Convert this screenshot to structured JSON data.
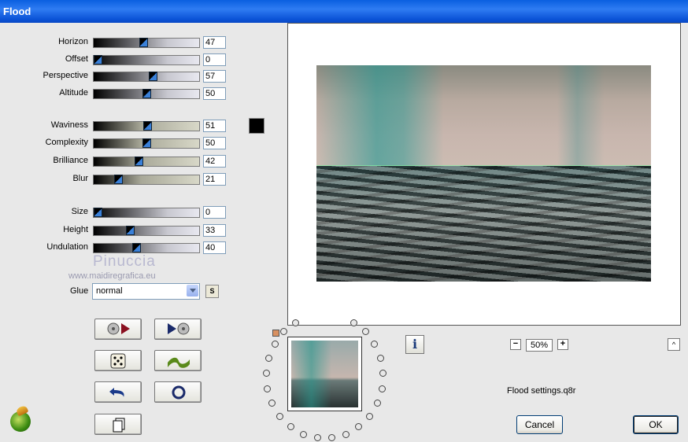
{
  "window": {
    "title": "Flood"
  },
  "params": [
    {
      "label": "Horizon",
      "value": "47",
      "fraction": 0.47,
      "style": "gray"
    },
    {
      "label": "Offset",
      "value": "0",
      "fraction": 0.0,
      "style": "gray"
    },
    {
      "label": "Perspective",
      "value": "57",
      "fraction": 0.57,
      "style": "gray"
    },
    {
      "label": "Altitude",
      "value": "50",
      "fraction": 0.5,
      "style": "gray"
    },
    {
      "label": "Waviness",
      "value": "51",
      "fraction": 0.51,
      "style": "beige"
    },
    {
      "label": "Complexity",
      "value": "50",
      "fraction": 0.5,
      "style": "beige"
    },
    {
      "label": "Brilliance",
      "value": "42",
      "fraction": 0.42,
      "style": "beige"
    },
    {
      "label": "Blur",
      "value": "21",
      "fraction": 0.21,
      "style": "beige"
    },
    {
      "label": "Size",
      "value": "0",
      "fraction": 0.0,
      "style": "gray"
    },
    {
      "label": "Height",
      "value": "33",
      "fraction": 0.33,
      "style": "gray"
    },
    {
      "label": "Undulation",
      "value": "40",
      "fraction": 0.4,
      "style": "gray"
    }
  ],
  "color_swatch": "#000000",
  "watermark": {
    "name": "Pinuccia",
    "url": "www.maidiregrafica.eu"
  },
  "glue": {
    "label": "Glue",
    "value": "normal",
    "s_button": "S"
  },
  "zoom": {
    "value": "50%",
    "minus": "−",
    "plus": "+"
  },
  "info_button": "i",
  "up_button": "^",
  "settings_file": "Flood settings.q8r",
  "buttons": {
    "cancel": "Cancel",
    "ok": "OK"
  },
  "icons": [
    "reset-left-icon",
    "reset-right-icon",
    "dice-icon",
    "wave-icon",
    "undo-icon",
    "circle-icon",
    "copy-icon",
    "logo-icon"
  ]
}
